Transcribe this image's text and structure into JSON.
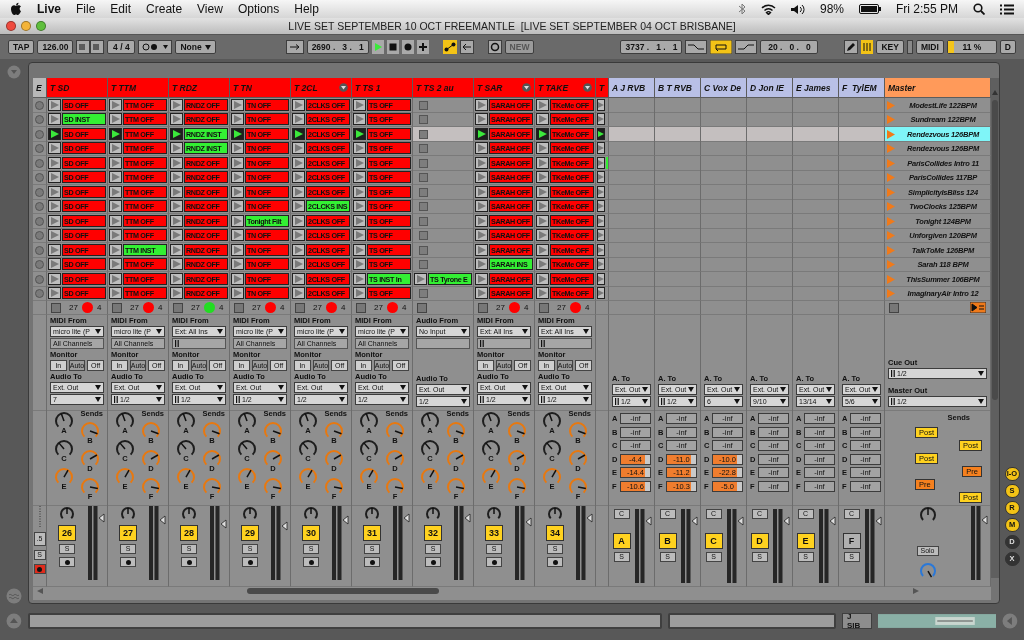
{
  "menubar": {
    "app": "Live",
    "menus": [
      "File",
      "Edit",
      "Create",
      "View",
      "Options",
      "Help"
    ],
    "battery": "98%",
    "clock": "Fri 2:55 PM"
  },
  "window": {
    "title": "LIVE SET SEPTEMBER 10 OCT FREEMANTLE  [LIVE SET SEPTEMBER 04 OCT BRISBANE]"
  },
  "control_bar": {
    "tap": "TAP",
    "tempo": "126.00",
    "signature": "4 / 4",
    "quantize": "None",
    "position": "2690 .   3 .   1",
    "new": "NEW",
    "loop_start": "3737 .   1 .   1",
    "loop_length": "20 .   0 .   0",
    "key": "KEY",
    "midi": "MIDI",
    "cpu": {
      "reading": "11 %",
      "level": 0.12
    },
    "disk": "D"
  },
  "scene_column": {
    "label": "E",
    "crossfade": ".5",
    "solo": "S"
  },
  "tracks": [
    {
      "name": "T SD",
      "kind": "midi",
      "menu": false,
      "arm": {
        "count": "27",
        "color": "#ff0000",
        "channel": "4"
      },
      "io": {
        "from_label": "MIDI From",
        "from": "micro lite (P",
        "channel": "All Channels",
        "channel_icon": false,
        "monitor_label": "Monitor",
        "monitor": [
          {
            "label": "In",
            "selected": false
          },
          {
            "label": "Auto",
            "selected": true
          },
          {
            "label": "Off",
            "selected": false
          }
        ],
        "to_label": "Audio To",
        "to": "Ext. Out",
        "out": "7",
        "out_icon": false
      },
      "sends_title": "Sends",
      "sends": [
        {
          "label": "A",
          "color": "#1e1e1e"
        },
        {
          "label": "B",
          "color": "#e8780f"
        },
        {
          "label": "C",
          "color": "#1e1e1e"
        },
        {
          "label": "D",
          "color": "#e8780f"
        },
        {
          "label": "E",
          "color": "#e8780f"
        },
        {
          "label": "F",
          "color": "#e8780f"
        }
      ],
      "number": "26",
      "solo": "S",
      "clips": [
        {
          "kind": "clip",
          "name": "SD OFF",
          "color": "#ff0000",
          "playing": false
        },
        {
          "kind": "clip",
          "name": "SD INST",
          "color": "#33f033",
          "playing": false
        },
        {
          "kind": "clip",
          "name": "SD OFF",
          "color": "#ff0000",
          "playing": true
        },
        {
          "kind": "clip",
          "name": "SD OFF",
          "color": "#ff0000",
          "playing": false
        },
        {
          "kind": "clip",
          "name": "SD OFF",
          "color": "#ff0000",
          "playing": false
        },
        {
          "kind": "clip",
          "name": "SD OFF",
          "color": "#ff0000",
          "playing": false
        },
        {
          "kind": "clip",
          "name": "SD OFF",
          "color": "#ff0000",
          "playing": false
        },
        {
          "kind": "clip",
          "name": "SD OFF",
          "color": "#ff0000",
          "playing": false
        },
        {
          "kind": "clip",
          "name": "SD OFF",
          "color": "#ff0000",
          "playing": false
        },
        {
          "kind": "clip",
          "name": "SD OFF",
          "color": "#ff0000",
          "playing": false
        },
        {
          "kind": "clip",
          "name": "SD OFF",
          "color": "#ff0000",
          "playing": false
        },
        {
          "kind": "clip",
          "name": "SD OFF",
          "color": "#ff0000",
          "playing": false
        },
        {
          "kind": "clip",
          "name": "SD OFF",
          "color": "#ff0000",
          "playing": false
        },
        {
          "kind": "clip",
          "name": "SD OFF",
          "color": "#ff0000",
          "playing": false
        }
      ]
    },
    {
      "name": "T TTM",
      "kind": "midi",
      "menu": false,
      "arm": {
        "count": "27",
        "color": "#ff0000",
        "channel": "4"
      },
      "io": {
        "from_label": "MIDI From",
        "from": "micro lite (P",
        "channel": "All Channels",
        "channel_icon": false,
        "monitor_label": "Monitor",
        "monitor": [
          {
            "label": "In",
            "selected": false
          },
          {
            "label": "Auto",
            "selected": true
          },
          {
            "label": "Off",
            "selected": false
          }
        ],
        "to_label": "Audio To",
        "to": "Ext. Out",
        "out": "1/2",
        "out_icon": true
      },
      "sends_title": "Sends",
      "sends": [
        {
          "label": "A",
          "color": "#1e1e1e"
        },
        {
          "label": "B",
          "color": "#e8780f"
        },
        {
          "label": "C",
          "color": "#1e1e1e"
        },
        {
          "label": "D",
          "color": "#e8780f"
        },
        {
          "label": "E",
          "color": "#e8780f"
        },
        {
          "label": "F",
          "color": "#e8780f"
        }
      ],
      "number": "27",
      "solo": "S",
      "clips": [
        {
          "kind": "clip",
          "name": "TTM OFF",
          "color": "#ff0000",
          "playing": false
        },
        {
          "kind": "clip",
          "name": "TTM OFF",
          "color": "#ff0000",
          "playing": false
        },
        {
          "kind": "clip",
          "name": "TTM OFF",
          "color": "#ff0000",
          "playing": true
        },
        {
          "kind": "clip",
          "name": "TTM OFF",
          "color": "#ff0000",
          "playing": false
        },
        {
          "kind": "clip",
          "name": "TTM OFF",
          "color": "#ff0000",
          "playing": false
        },
        {
          "kind": "clip",
          "name": "TTM OFF",
          "color": "#ff0000",
          "playing": false
        },
        {
          "kind": "clip",
          "name": "TTM OFF",
          "color": "#ff0000",
          "playing": false
        },
        {
          "kind": "clip",
          "name": "TTM OFF",
          "color": "#ff0000",
          "playing": false
        },
        {
          "kind": "clip",
          "name": "TTM OFF",
          "color": "#ff0000",
          "playing": false
        },
        {
          "kind": "clip",
          "name": "TTM OFF",
          "color": "#ff0000",
          "playing": false
        },
        {
          "kind": "clip",
          "name": "TTM INST",
          "color": "#33f033",
          "playing": false
        },
        {
          "kind": "clip",
          "name": "TTM OFF",
          "color": "#ff0000",
          "playing": false
        },
        {
          "kind": "clip",
          "name": "TTM OFF",
          "color": "#ff0000",
          "playing": false
        },
        {
          "kind": "clip",
          "name": "TTM OFF",
          "color": "#ff0000",
          "playing": false
        }
      ]
    },
    {
      "name": "T RDZ",
      "kind": "midi",
      "menu": false,
      "arm": {
        "count": "27",
        "color": "#22dd22",
        "channel": "4"
      },
      "io": {
        "from_label": "MIDI From",
        "from": "Ext: All Ins",
        "channel_icon": true,
        "monitor_label": "Monitor",
        "monitor": [
          {
            "label": "In",
            "selected": false
          },
          {
            "label": "Auto",
            "selected": true
          },
          {
            "label": "Off",
            "selected": false
          }
        ],
        "to_label": "Audio To",
        "to": "Ext. Out",
        "out": "1/2",
        "out_icon": true
      },
      "sends_title": "Sends",
      "sends": [
        {
          "label": "A",
          "color": "#1e1e1e"
        },
        {
          "label": "B",
          "color": "#e8780f"
        },
        {
          "label": "C",
          "color": "#1e1e1e"
        },
        {
          "label": "D",
          "color": "#e8780f"
        },
        {
          "label": "E",
          "color": "#e8780f"
        },
        {
          "label": "F",
          "color": "#e8780f"
        }
      ],
      "number": "28",
      "solo": "S",
      "clips": [
        {
          "kind": "clip",
          "name": "RNDZ OFF",
          "color": "#ff0000",
          "playing": false
        },
        {
          "kind": "clip",
          "name": "RNDZ OFF",
          "color": "#ff0000",
          "playing": false
        },
        {
          "kind": "clip",
          "name": "RNDZ INST",
          "color": "#33f033",
          "playing": true
        },
        {
          "kind": "clip",
          "name": "RNDZ INST",
          "color": "#33f033",
          "playing": false
        },
        {
          "kind": "clip",
          "name": "RNDZ OFF",
          "color": "#ff0000",
          "playing": false
        },
        {
          "kind": "clip",
          "name": "RNDZ OFF",
          "color": "#ff0000",
          "playing": false
        },
        {
          "kind": "clip",
          "name": "RNDZ OFF",
          "color": "#ff0000",
          "playing": false
        },
        {
          "kind": "clip",
          "name": "RNDZ OFF",
          "color": "#ff0000",
          "playing": false
        },
        {
          "kind": "clip",
          "name": "RNDZ OFF",
          "color": "#ff0000",
          "playing": false
        },
        {
          "kind": "clip",
          "name": "RNDZ OFF",
          "color": "#ff0000",
          "playing": false
        },
        {
          "kind": "clip",
          "name": "RNDZ OFF",
          "color": "#ff0000",
          "playing": false
        },
        {
          "kind": "clip",
          "name": "RNDZ OFF",
          "color": "#ff0000",
          "playing": false
        },
        {
          "kind": "clip",
          "name": "RNDZ OFF",
          "color": "#ff0000",
          "playing": false
        },
        {
          "kind": "clip",
          "name": "RNDZ OFF",
          "color": "#ff0000",
          "playing": false
        }
      ]
    },
    {
      "name": "T TN",
      "kind": "midi",
      "menu": false,
      "arm": {
        "count": "27",
        "color": "#ff0000",
        "channel": "4"
      },
      "io": {
        "from_label": "MIDI From",
        "from": "micro lite (P",
        "channel": "All Channels",
        "channel_icon": false,
        "monitor_label": "Monitor",
        "monitor": [
          {
            "label": "In",
            "selected": false
          },
          {
            "label": "Auto",
            "selected": true
          },
          {
            "label": "Off",
            "selected": false
          }
        ],
        "to_label": "Audio To",
        "to": "Ext. Out",
        "out": "1/2",
        "out_icon": true
      },
      "sends_title": "Sends",
      "sends": [
        {
          "label": "A",
          "color": "#1e1e1e"
        },
        {
          "label": "B",
          "color": "#e8780f"
        },
        {
          "label": "C",
          "color": "#1e1e1e"
        },
        {
          "label": "D",
          "color": "#e8780f"
        },
        {
          "label": "E",
          "color": "#e8780f"
        },
        {
          "label": "F",
          "color": "#e8780f"
        }
      ],
      "number": "29",
      "solo": "S",
      "clips": [
        {
          "kind": "clip",
          "name": "TN OFF",
          "color": "#ff0000",
          "playing": false
        },
        {
          "kind": "clip",
          "name": "TN OFF",
          "color": "#ff0000",
          "playing": false
        },
        {
          "kind": "clip",
          "name": "TN OFF",
          "color": "#ff0000",
          "playing": true
        },
        {
          "kind": "clip",
          "name": "TN OFF",
          "color": "#ff0000",
          "playing": false
        },
        {
          "kind": "clip",
          "name": "TN OFF",
          "color": "#ff0000",
          "playing": false
        },
        {
          "kind": "clip",
          "name": "TN OFF",
          "color": "#ff0000",
          "playing": false
        },
        {
          "kind": "clip",
          "name": "TN OFF",
          "color": "#ff0000",
          "playing": false
        },
        {
          "kind": "clip",
          "name": "TN OFF",
          "color": "#ff0000",
          "playing": false
        },
        {
          "kind": "clip",
          "name": "Tonight Filt",
          "color": "#33f033",
          "playing": false
        },
        {
          "kind": "clip",
          "name": "TN OFF",
          "color": "#ff0000",
          "playing": false
        },
        {
          "kind": "clip",
          "name": "TN OFF",
          "color": "#ff0000",
          "playing": false
        },
        {
          "kind": "clip",
          "name": "TN OFF",
          "color": "#ff0000",
          "playing": false
        },
        {
          "kind": "clip",
          "name": "TN OFF",
          "color": "#ff0000",
          "playing": false
        },
        {
          "kind": "clip",
          "name": "TN OFF",
          "color": "#ff0000",
          "playing": false
        }
      ]
    },
    {
      "name": "T 2CL",
      "kind": "midi",
      "menu": true,
      "arm": {
        "count": "27",
        "color": "#ff0000",
        "channel": "4"
      },
      "io": {
        "from_label": "MIDI From",
        "from": "micro lite (P",
        "channel": "All Channels",
        "channel_icon": false,
        "monitor_label": "Monitor",
        "monitor": [
          {
            "label": "In",
            "selected": false
          },
          {
            "label": "Auto",
            "selected": true
          },
          {
            "label": "Off",
            "selected": false
          }
        ],
        "to_label": "Audio To",
        "to": "Ext. Out",
        "out": "1/2",
        "out_icon": false
      },
      "sends_title": "Sends",
      "sends": [
        {
          "label": "A",
          "color": "#1e1e1e"
        },
        {
          "label": "B",
          "color": "#e8780f"
        },
        {
          "label": "C",
          "color": "#1e1e1e"
        },
        {
          "label": "D",
          "color": "#e8780f"
        },
        {
          "label": "E",
          "color": "#e8780f"
        },
        {
          "label": "F",
          "color": "#e8780f"
        }
      ],
      "number": "30",
      "solo": "S",
      "clips": [
        {
          "kind": "clip",
          "name": "2CLKS OFF",
          "color": "#ff0000",
          "playing": false
        },
        {
          "kind": "clip",
          "name": "2CLKS OFF",
          "color": "#ff0000",
          "playing": false
        },
        {
          "kind": "clip",
          "name": "2CLKS OFF",
          "color": "#ff0000",
          "playing": true
        },
        {
          "kind": "clip",
          "name": "2CLKS OFF",
          "color": "#ff0000",
          "playing": false
        },
        {
          "kind": "clip",
          "name": "2CLKS OFF",
          "color": "#ff0000",
          "playing": false
        },
        {
          "kind": "clip",
          "name": "2CLKS OFF",
          "color": "#ff0000",
          "playing": false
        },
        {
          "kind": "clip",
          "name": "2CLKS OFF",
          "color": "#ff0000",
          "playing": false
        },
        {
          "kind": "clip",
          "name": "2CLCKS INS",
          "color": "#33f033",
          "playing": false
        },
        {
          "kind": "clip",
          "name": "2CLKS OFF",
          "color": "#ff0000",
          "playing": false
        },
        {
          "kind": "clip",
          "name": "2CLKS OFF",
          "color": "#ff0000",
          "playing": false
        },
        {
          "kind": "clip",
          "name": "2CLKS OFF",
          "color": "#ff0000",
          "playing": false
        },
        {
          "kind": "clip",
          "name": "2CLKS OFF",
          "color": "#ff0000",
          "playing": false
        },
        {
          "kind": "clip",
          "name": "2CLKS OFF",
          "color": "#ff0000",
          "playing": false
        },
        {
          "kind": "clip",
          "name": "2CLKS OFF",
          "color": "#ff0000",
          "playing": false
        }
      ]
    },
    {
      "name": "T TS 1",
      "kind": "midi",
      "menu": false,
      "arm": {
        "count": "27",
        "color": "#ff0000",
        "channel": "4"
      },
      "io": {
        "from_label": "MIDI From",
        "from": "micro lite (P",
        "channel": "All Channels",
        "channel_icon": false,
        "monitor_label": "Monitor",
        "monitor": [
          {
            "label": "In",
            "selected": false
          },
          {
            "label": "Auto",
            "selected": true
          },
          {
            "label": "Off",
            "selected": false
          }
        ],
        "to_label": "Audio To",
        "to": "Ext. Out",
        "out": "1/2",
        "out_icon": false
      },
      "sends_title": "Sends",
      "sends": [
        {
          "label": "A",
          "color": "#1e1e1e"
        },
        {
          "label": "B",
          "color": "#e8780f"
        },
        {
          "label": "C",
          "color": "#1e1e1e"
        },
        {
          "label": "D",
          "color": "#e8780f"
        },
        {
          "label": "E",
          "color": "#e8780f"
        },
        {
          "label": "F",
          "color": "#e8780f"
        }
      ],
      "number": "31",
      "solo": "S",
      "clips": [
        {
          "kind": "clip",
          "name": "TS OFF",
          "color": "#ff0000",
          "playing": false
        },
        {
          "kind": "clip",
          "name": "TS OFF",
          "color": "#ff0000",
          "playing": false
        },
        {
          "kind": "clip",
          "name": "TS OFF",
          "color": "#ff0000",
          "playing": true
        },
        {
          "kind": "clip",
          "name": "TS OFF",
          "color": "#ff0000",
          "playing": false
        },
        {
          "kind": "clip",
          "name": "TS OFF",
          "color": "#ff0000",
          "playing": false
        },
        {
          "kind": "clip",
          "name": "TS OFF",
          "color": "#ff0000",
          "playing": false
        },
        {
          "kind": "clip",
          "name": "TS OFF",
          "color": "#ff0000",
          "playing": false
        },
        {
          "kind": "clip",
          "name": "TS OFF",
          "color": "#ff0000",
          "playing": false
        },
        {
          "kind": "clip",
          "name": "TS OFF",
          "color": "#ff0000",
          "playing": false
        },
        {
          "kind": "clip",
          "name": "TS OFF",
          "color": "#ff0000",
          "playing": false
        },
        {
          "kind": "clip",
          "name": "TS OFF",
          "color": "#ff0000",
          "playing": false
        },
        {
          "kind": "clip",
          "name": "TS OFF",
          "color": "#ff0000",
          "playing": false
        },
        {
          "kind": "clip",
          "name": "TS INST In",
          "color": "#33f033",
          "playing": false
        },
        {
          "kind": "clip",
          "name": "TS OFF",
          "color": "#ff0000",
          "playing": false
        }
      ]
    },
    {
      "name": "T TS 2 au",
      "kind": "audio",
      "menu": false,
      "io": {
        "from_label": "Audio From",
        "from": "No Input",
        "channel_icon": false,
        "to_label": "Audio To",
        "to": "Ext. Out",
        "out": "1/2",
        "out_icon": false
      },
      "sends_title": "Sends",
      "sends": [
        {
          "label": "A",
          "color": "#1e1e1e"
        },
        {
          "label": "B",
          "color": "#e8780f"
        },
        {
          "label": "C",
          "color": "#1e1e1e"
        },
        {
          "label": "D",
          "color": "#e8780f"
        },
        {
          "label": "E",
          "color": "#e8780f"
        },
        {
          "label": "F",
          "color": "#e8780f"
        }
      ],
      "number": "32",
      "solo": "S",
      "clips": [
        {
          "kind": "empty",
          "playing": false
        },
        {
          "kind": "empty",
          "playing": false
        },
        {
          "kind": "empty",
          "playing": false
        },
        {
          "kind": "empty",
          "playing": false
        },
        {
          "kind": "empty",
          "playing": false
        },
        {
          "kind": "empty",
          "playing": false
        },
        {
          "kind": "empty",
          "playing": false
        },
        {
          "kind": "empty",
          "playing": false
        },
        {
          "kind": "empty",
          "playing": false
        },
        {
          "kind": "empty",
          "playing": false
        },
        {
          "kind": "empty",
          "playing": false
        },
        {
          "kind": "empty",
          "playing": false
        },
        {
          "kind": "clip",
          "name": "TS Tyrone E",
          "color": "#33f033",
          "playing": false
        },
        {
          "kind": "empty",
          "playing": false
        }
      ]
    },
    {
      "name": "T SAR",
      "kind": "midi",
      "menu": true,
      "arm": {
        "count": "27",
        "color": "#ff0000",
        "channel": "4"
      },
      "io": {
        "from_label": "MIDI From",
        "from": "Ext: All Ins",
        "channel_icon": true,
        "monitor_label": "Monitor",
        "monitor": [
          {
            "label": "In",
            "selected": false
          },
          {
            "label": "Auto",
            "selected": true
          },
          {
            "label": "Off",
            "selected": false
          }
        ],
        "to_label": "Audio To",
        "to": "Ext. Out",
        "out": "1/2",
        "out_icon": true
      },
      "sends_title": "Sends",
      "sends": [
        {
          "label": "A",
          "color": "#1e1e1e"
        },
        {
          "label": "B",
          "color": "#e8780f"
        },
        {
          "label": "C",
          "color": "#1e1e1e"
        },
        {
          "label": "D",
          "color": "#e8780f"
        },
        {
          "label": "E",
          "color": "#e8780f"
        },
        {
          "label": "F",
          "color": "#e8780f"
        }
      ],
      "number": "33",
      "solo": "S",
      "clips": [
        {
          "kind": "clip",
          "name": "SARAH OFF",
          "color": "#ff0000",
          "playing": false
        },
        {
          "kind": "clip",
          "name": "SARAH OFF",
          "color": "#ff0000",
          "playing": false
        },
        {
          "kind": "clip",
          "name": "SARAH OFF",
          "color": "#ff0000",
          "playing": true
        },
        {
          "kind": "clip",
          "name": "SARAH OFF",
          "color": "#ff0000",
          "playing": false
        },
        {
          "kind": "clip",
          "name": "SARAH OFF",
          "color": "#ff0000",
          "playing": false
        },
        {
          "kind": "clip",
          "name": "SARAH OFF",
          "color": "#ff0000",
          "playing": false
        },
        {
          "kind": "clip",
          "name": "SARAH OFF",
          "color": "#ff0000",
          "playing": false
        },
        {
          "kind": "clip",
          "name": "SARAH OFF",
          "color": "#ff0000",
          "playing": false
        },
        {
          "kind": "clip",
          "name": "SARAH OFF",
          "color": "#ff0000",
          "playing": false
        },
        {
          "kind": "clip",
          "name": "SARAH OFF",
          "color": "#ff0000",
          "playing": false
        },
        {
          "kind": "clip",
          "name": "SARAH OFF",
          "color": "#ff0000",
          "playing": false
        },
        {
          "kind": "clip",
          "name": "SARAH INS",
          "color": "#33f033",
          "playing": false
        },
        {
          "kind": "clip",
          "name": "SARAH OFF",
          "color": "#ff0000",
          "playing": false
        },
        {
          "kind": "clip",
          "name": "SARAH OFF",
          "color": "#ff0000",
          "playing": false
        }
      ]
    },
    {
      "name": "T TAKE",
      "kind": "midi",
      "menu": true,
      "arm": {
        "count": "27",
        "color": "#ff0000",
        "channel": "4"
      },
      "io": {
        "from_label": "MIDI From",
        "from": "Ext: All Ins",
        "channel_icon": true,
        "monitor_label": "Monitor",
        "monitor": [
          {
            "label": "In",
            "selected": false
          },
          {
            "label": "Auto",
            "selected": true
          },
          {
            "label": "Off",
            "selected": false
          }
        ],
        "to_label": "Audio To",
        "to": "Ext. Out",
        "out": "1/2",
        "out_icon": true
      },
      "sends_title": "Sends",
      "sends": [
        {
          "label": "A",
          "color": "#1e1e1e"
        },
        {
          "label": "B",
          "color": "#e8780f"
        },
        {
          "label": "C",
          "color": "#1e1e1e"
        },
        {
          "label": "D",
          "color": "#e8780f"
        },
        {
          "label": "E",
          "color": "#e8780f"
        },
        {
          "label": "F",
          "color": "#e8780f"
        }
      ],
      "number": "34",
      "solo": "S",
      "clips": [
        {
          "kind": "clip",
          "name": "TKeMe OFF",
          "color": "#ff0000",
          "playing": false
        },
        {
          "kind": "clip",
          "name": "TKeMe OFF",
          "color": "#ff0000",
          "playing": false
        },
        {
          "kind": "clip",
          "name": "TKeMe OFF",
          "color": "#ff0000",
          "playing": true
        },
        {
          "kind": "clip",
          "name": "TKeMe OFF",
          "color": "#ff0000",
          "playing": false
        },
        {
          "kind": "clip",
          "name": "TKeMe OFF",
          "color": "#ff0000",
          "playing": false
        },
        {
          "kind": "clip",
          "name": "TKeMe OFF",
          "color": "#ff0000",
          "playing": false
        },
        {
          "kind": "clip",
          "name": "TKeMe OFF",
          "color": "#ff0000",
          "playing": false
        },
        {
          "kind": "clip",
          "name": "TKeMe OFF",
          "color": "#ff0000",
          "playing": false
        },
        {
          "kind": "clip",
          "name": "TKeMe OFF",
          "color": "#ff0000",
          "playing": false
        },
        {
          "kind": "clip",
          "name": "TKeMe OFF",
          "color": "#ff0000",
          "playing": false
        },
        {
          "kind": "clip",
          "name": "TKeMe OFF",
          "color": "#ff0000",
          "playing": false
        },
        {
          "kind": "clip",
          "name": "TKeMe OFF",
          "color": "#ff0000",
          "playing": false
        },
        {
          "kind": "clip",
          "name": "TKeMe OFF",
          "color": "#ff0000",
          "playing": false
        },
        {
          "kind": "clip",
          "name": "TKeMe OFF",
          "color": "#ff0000",
          "playing": false
        }
      ]
    },
    {
      "name": "T",
      "kind": "edge",
      "menu": false,
      "clips": [
        {
          "kind": "clip",
          "playing": false
        },
        {
          "kind": "clip",
          "playing": false
        },
        {
          "kind": "clip",
          "playing": true
        },
        {
          "kind": "clip",
          "playing": false
        },
        {
          "kind": "clip",
          "color": "#33f033",
          "playing": false
        },
        {
          "kind": "clip",
          "playing": false
        },
        {
          "kind": "clip",
          "playing": false
        },
        {
          "kind": "clip",
          "playing": false
        },
        {
          "kind": "clip",
          "playing": false
        },
        {
          "kind": "clip",
          "playing": false
        },
        {
          "kind": "clip",
          "playing": false
        },
        {
          "kind": "clip",
          "playing": false
        },
        {
          "kind": "clip",
          "playing": false
        },
        {
          "kind": "clip",
          "playing": false
        }
      ]
    }
  ],
  "returns": [
    {
      "name": "A J RVB",
      "to_label": "A. To",
      "to": "Ext. Out",
      "out": "1/2",
      "out_icon": true,
      "sends": [
        {
          "label": "A",
          "value": "-inf",
          "on": false
        },
        {
          "label": "B",
          "value": "-inf",
          "on": false
        },
        {
          "label": "C",
          "value": "-inf",
          "on": false
        },
        {
          "label": "D",
          "value": "-4.4",
          "on": true
        },
        {
          "label": "E",
          "value": "-14.4",
          "on": true
        },
        {
          "label": "F",
          "value": "-10.6",
          "on": true
        }
      ],
      "cue": "C",
      "letter": "A",
      "active": true,
      "solo": "S"
    },
    {
      "name": "B T RVB",
      "to_label": "A. To",
      "to": "Ext. Out",
      "out": "1/2",
      "out_icon": true,
      "sends": [
        {
          "label": "A",
          "value": "-inf",
          "on": false
        },
        {
          "label": "B",
          "value": "-inf",
          "on": false
        },
        {
          "label": "C",
          "value": "-inf",
          "on": false
        },
        {
          "label": "D",
          "value": "-11.0",
          "on": true
        },
        {
          "label": "E",
          "value": "-11.2",
          "on": true
        },
        {
          "label": "F",
          "value": "-10.3",
          "on": true
        }
      ],
      "cue": "C",
      "letter": "B",
      "active": true,
      "solo": "S"
    },
    {
      "name": "C Vox De",
      "to_label": "A. To",
      "to": "Ext. Out",
      "out": "6",
      "out_icon": false,
      "sends": [
        {
          "label": "A",
          "value": "-inf",
          "on": false
        },
        {
          "label": "B",
          "value": "-inf",
          "on": false
        },
        {
          "label": "C",
          "value": "-inf",
          "on": false
        },
        {
          "label": "D",
          "value": "-10.0",
          "on": true
        },
        {
          "label": "E",
          "value": "-22.8",
          "on": true
        },
        {
          "label": "F",
          "value": "-5.0",
          "on": true
        }
      ],
      "cue": "C",
      "letter": "C",
      "active": true,
      "solo": "S"
    },
    {
      "name": "D Jon IE",
      "to_label": "A. To",
      "to": "Ext. Out",
      "out": "9/10",
      "out_icon": false,
      "sends": [
        {
          "label": "A",
          "value": "-inf",
          "on": false
        },
        {
          "label": "B",
          "value": "-inf",
          "on": false
        },
        {
          "label": "C",
          "value": "-inf",
          "on": false
        },
        {
          "label": "D",
          "value": "-inf",
          "on": false
        },
        {
          "label": "E",
          "value": "-inf",
          "on": false
        },
        {
          "label": "F",
          "value": "-inf",
          "on": false
        }
      ],
      "cue": "C",
      "letter": "D",
      "active": true,
      "solo": "S"
    },
    {
      "name": "E James",
      "to_label": "A. To",
      "to": "Ext. Out",
      "out": "13/14",
      "out_icon": false,
      "sends": [
        {
          "label": "A",
          "value": "-inf",
          "on": false
        },
        {
          "label": "B",
          "value": "-inf",
          "on": false
        },
        {
          "label": "C",
          "value": "-inf",
          "on": false
        },
        {
          "label": "D",
          "value": "-inf",
          "on": false
        },
        {
          "label": "E",
          "value": "-inf",
          "on": false
        },
        {
          "label": "F",
          "value": "-inf",
          "on": false
        }
      ],
      "cue": "C",
      "letter": "E",
      "active": true,
      "solo": "S"
    },
    {
      "name": "F  TylEM",
      "to_label": "A. To",
      "to": "Ext. Out",
      "out": "5/6",
      "out_icon": false,
      "sends": [
        {
          "label": "A",
          "value": "-inf",
          "on": false
        },
        {
          "label": "B",
          "value": "-inf",
          "on": false
        },
        {
          "label": "C",
          "value": "-inf",
          "on": false
        },
        {
          "label": "D",
          "value": "-inf",
          "on": false
        },
        {
          "label": "E",
          "value": "-inf",
          "on": false
        },
        {
          "label": "F",
          "value": "-inf",
          "on": false
        }
      ],
      "cue": "C",
      "letter": "F",
      "active": false,
      "solo": "S"
    }
  ],
  "master": {
    "name": "Master",
    "scenes": [
      {
        "name": "ModestLife 122BPM",
        "selected": false
      },
      {
        "name": "Sundream 122BPM",
        "selected": false
      },
      {
        "name": "Rendezvous 126BPM",
        "selected": true
      },
      {
        "name": "Rendezvous 126BPM",
        "selected": false
      },
      {
        "name": "ParisCollides Intro 11",
        "selected": false
      },
      {
        "name": "ParisCollides 117BP",
        "selected": false
      },
      {
        "name": "SimplicityIsBliss 124",
        "selected": false
      },
      {
        "name": "TwoClocks 125BPM",
        "selected": false
      },
      {
        "name": "Tonight 124BPM",
        "selected": false
      },
      {
        "name": "Unforgiven 120BPM",
        "selected": false
      },
      {
        "name": "TalkToMe 126BPM",
        "selected": false
      },
      {
        "name": "Sarah 118 BPM",
        "selected": false
      },
      {
        "name": "ThisSummer 106BPM",
        "selected": false
      },
      {
        "name": "ImaginaryAir Intro 12",
        "selected": false
      }
    ],
    "cue_label": "Cue Out",
    "cue": "1/2",
    "out_label": "Master Out",
    "out": "1/2",
    "sends_title": "Sends",
    "send_modes": [
      {
        "label": "Post",
        "kind": "post"
      },
      {
        "label": "Post",
        "kind": "post"
      },
      {
        "label": "Post",
        "kind": "post"
      },
      {
        "label": "Pre",
        "kind": "pre"
      },
      {
        "label": "Pre",
        "kind": "pre"
      },
      {
        "label": "Post",
        "kind": "post"
      }
    ],
    "solo": "Solo"
  },
  "view_buttons": [
    {
      "label": "I-O",
      "on": true
    },
    {
      "label": "S",
      "on": true
    },
    {
      "label": "R",
      "on": true
    },
    {
      "label": "M",
      "on": true
    },
    {
      "label": "D",
      "on": false
    },
    {
      "label": "X",
      "on": false
    }
  ],
  "status_bar": {
    "track": "J SIB"
  }
}
